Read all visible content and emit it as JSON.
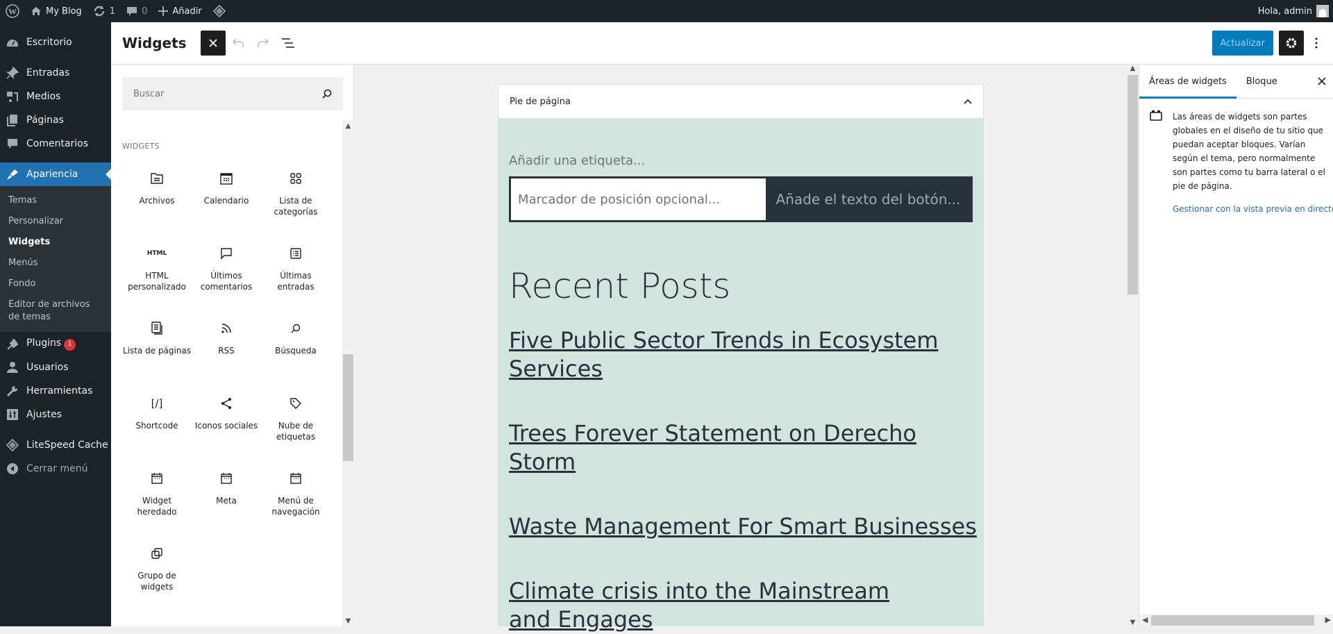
{
  "adminbar": {
    "site_name": "My Blog",
    "updates_count": "1",
    "comments_count": "0",
    "new_label": "Añadir",
    "greeting": "Hola, admin"
  },
  "sidebar": {
    "items": [
      {
        "label": "Escritorio",
        "icon": "dashboard-icon"
      },
      {
        "label": "Entradas",
        "icon": "pin-icon"
      },
      {
        "label": "Medios",
        "icon": "media-icon"
      },
      {
        "label": "Páginas",
        "icon": "pages-icon"
      },
      {
        "label": "Comentarios",
        "icon": "comments-icon"
      },
      {
        "label": "Apariencia",
        "icon": "appearance-icon"
      },
      {
        "label": "Plugins",
        "icon": "plugins-icon",
        "badge": "1"
      },
      {
        "label": "Usuarios",
        "icon": "users-icon"
      },
      {
        "label": "Herramientas",
        "icon": "tools-icon"
      },
      {
        "label": "Ajustes",
        "icon": "settings-icon"
      },
      {
        "label": "LiteSpeed Cache",
        "icon": "litespeed-icon"
      },
      {
        "label": "Cerrar menú",
        "icon": "collapse-icon"
      }
    ],
    "submenu": [
      "Temas",
      "Personalizar",
      "Widgets",
      "Menús",
      "Fondo",
      "Editor de archivos de temas"
    ]
  },
  "header": {
    "title": "Widgets",
    "update_label": "Actualizar"
  },
  "inserter": {
    "search_placeholder": "Buscar",
    "category": "WIDGETS",
    "widgets": [
      {
        "label": "Archivos",
        "icon": "archive-icon"
      },
      {
        "label": "Calendario",
        "icon": "calendar-icon"
      },
      {
        "label": "Lista de categorías",
        "icon": "categories-icon"
      },
      {
        "label": "HTML personalizado",
        "icon": "html-icon"
      },
      {
        "label": "Últimos comentarios",
        "icon": "comment-icon"
      },
      {
        "label": "Últimas entradas",
        "icon": "post-list-icon"
      },
      {
        "label": "Lista de páginas",
        "icon": "page-list-icon"
      },
      {
        "label": "RSS",
        "icon": "rss-icon"
      },
      {
        "label": "Búsqueda",
        "icon": "search-icon"
      },
      {
        "label": "Shortcode",
        "icon": "shortcode-icon"
      },
      {
        "label": "Iconos sociales",
        "icon": "share-icon"
      },
      {
        "label": "Nube de etiquetas",
        "icon": "tag-icon"
      },
      {
        "label": "Widget heredado",
        "icon": "widget-icon"
      },
      {
        "label": "Meta",
        "icon": "widget-icon"
      },
      {
        "label": "Menú de navegación",
        "icon": "widget-icon"
      },
      {
        "label": "Grupo de widgets",
        "icon": "group-icon"
      }
    ],
    "html_glyph": "HTML",
    "shortcode_glyph": "[/]"
  },
  "editor": {
    "area_title": "Pie de página",
    "search_label_placeholder": "Añadir una etiqueta...",
    "search_input_placeholder": "Marcador de posición opcional...",
    "search_button_placeholder": "Añade el texto del botón...",
    "recent_posts_title": "Recent Posts",
    "posts": [
      "Five Public Sector Trends in Ecosystem Services",
      "Trees Forever Statement on Derecho Storm",
      "Waste Management For Smart Businesses",
      "Climate crisis into the Mainstream and Engages"
    ]
  },
  "settings": {
    "tabs": [
      "Áreas de widgets",
      "Bloque"
    ],
    "description": "Las áreas de widgets son partes globales en el diseño de tu sitio que puedan aceptar bloques. Varían según el tema, pero normalmente son partes como tu barra lateral o el pie de página.",
    "link": "Gestionar con la vista previa en directo"
  }
}
